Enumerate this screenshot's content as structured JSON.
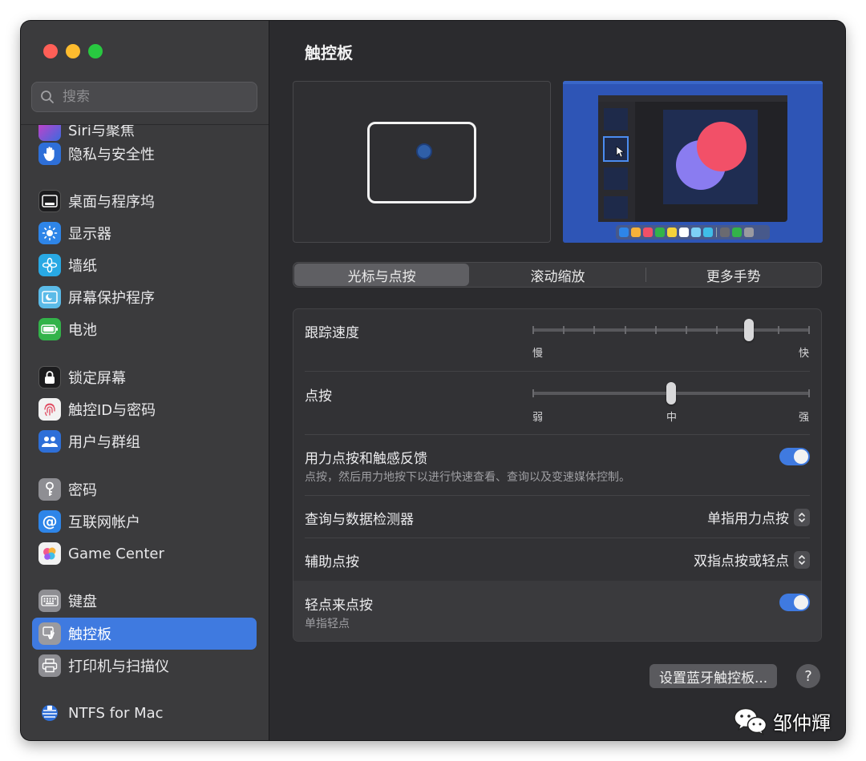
{
  "window": {
    "title": "触控板"
  },
  "sidebar": {
    "search_placeholder": "搜索",
    "partial_item": "Siri与聚焦",
    "items": [
      {
        "label": "隐私与安全性",
        "icon": "hand-icon",
        "color": "#2e6fd8"
      },
      {
        "label": "桌面与程序坞",
        "icon": "dock-icon",
        "color": "#1c1c1e"
      },
      {
        "label": "显示器",
        "icon": "sun-icon",
        "color": "#2e85e8"
      },
      {
        "label": "墙纸",
        "icon": "flower-icon",
        "color": "#29a9e4"
      },
      {
        "label": "屏幕保护程序",
        "icon": "screensaver-icon",
        "color": "#5bbbe8"
      },
      {
        "label": "电池",
        "icon": "battery-icon",
        "color": "#33b34a"
      },
      {
        "label": "锁定屏幕",
        "icon": "lock-icon",
        "color": "#1c1c1e"
      },
      {
        "label": "触控ID与密码",
        "icon": "fingerprint-icon",
        "color": "#f2f2f2"
      },
      {
        "label": "用户与群组",
        "icon": "users-icon",
        "color": "#2e6fd8"
      },
      {
        "label": "密码",
        "icon": "key-icon",
        "color": "#8e8e93"
      },
      {
        "label": "互联网帐户",
        "icon": "at-icon",
        "color": "#2e85e8"
      },
      {
        "label": "Game Center",
        "icon": "game-center-icon",
        "color": "#f2f2f2"
      },
      {
        "label": "键盘",
        "icon": "keyboard-icon",
        "color": "#8e8e93"
      },
      {
        "label": "触控板",
        "icon": "trackpad-icon",
        "color": "#8e8e93"
      },
      {
        "label": "打印机与扫描仪",
        "icon": "printer-icon",
        "color": "#8e8e93"
      },
      {
        "label": "NTFS for Mac",
        "icon": "ntfs-icon",
        "color": "#2e6fd8"
      }
    ],
    "active_index": 13
  },
  "tabs": [
    {
      "label": "光标与点按",
      "active": true
    },
    {
      "label": "滚动缩放",
      "active": false
    },
    {
      "label": "更多手势",
      "active": false
    }
  ],
  "settings": {
    "tracking_speed": {
      "label": "跟踪速度",
      "min_label": "慢",
      "max_label": "快",
      "value": 0.78
    },
    "click": {
      "label": "点按",
      "labels": [
        "弱",
        "中",
        "强"
      ],
      "value": 0.5
    },
    "force_click": {
      "label": "用力点按和触感反馈",
      "description": "点按，然后用力地按下以进行快速查看、查询以及变速媒体控制。",
      "enabled": true
    },
    "lookup": {
      "label": "查询与数据检测器",
      "value": "单指用力点按"
    },
    "secondary_click": {
      "label": "辅助点按",
      "value": "双指点按或轻点"
    },
    "tap_to_click": {
      "label": "轻点来点按",
      "description": "单指轻点",
      "enabled": true
    }
  },
  "buttons": {
    "bluetooth": "设置蓝牙触控板...",
    "help": "?"
  },
  "watermark": "邹仲輝"
}
